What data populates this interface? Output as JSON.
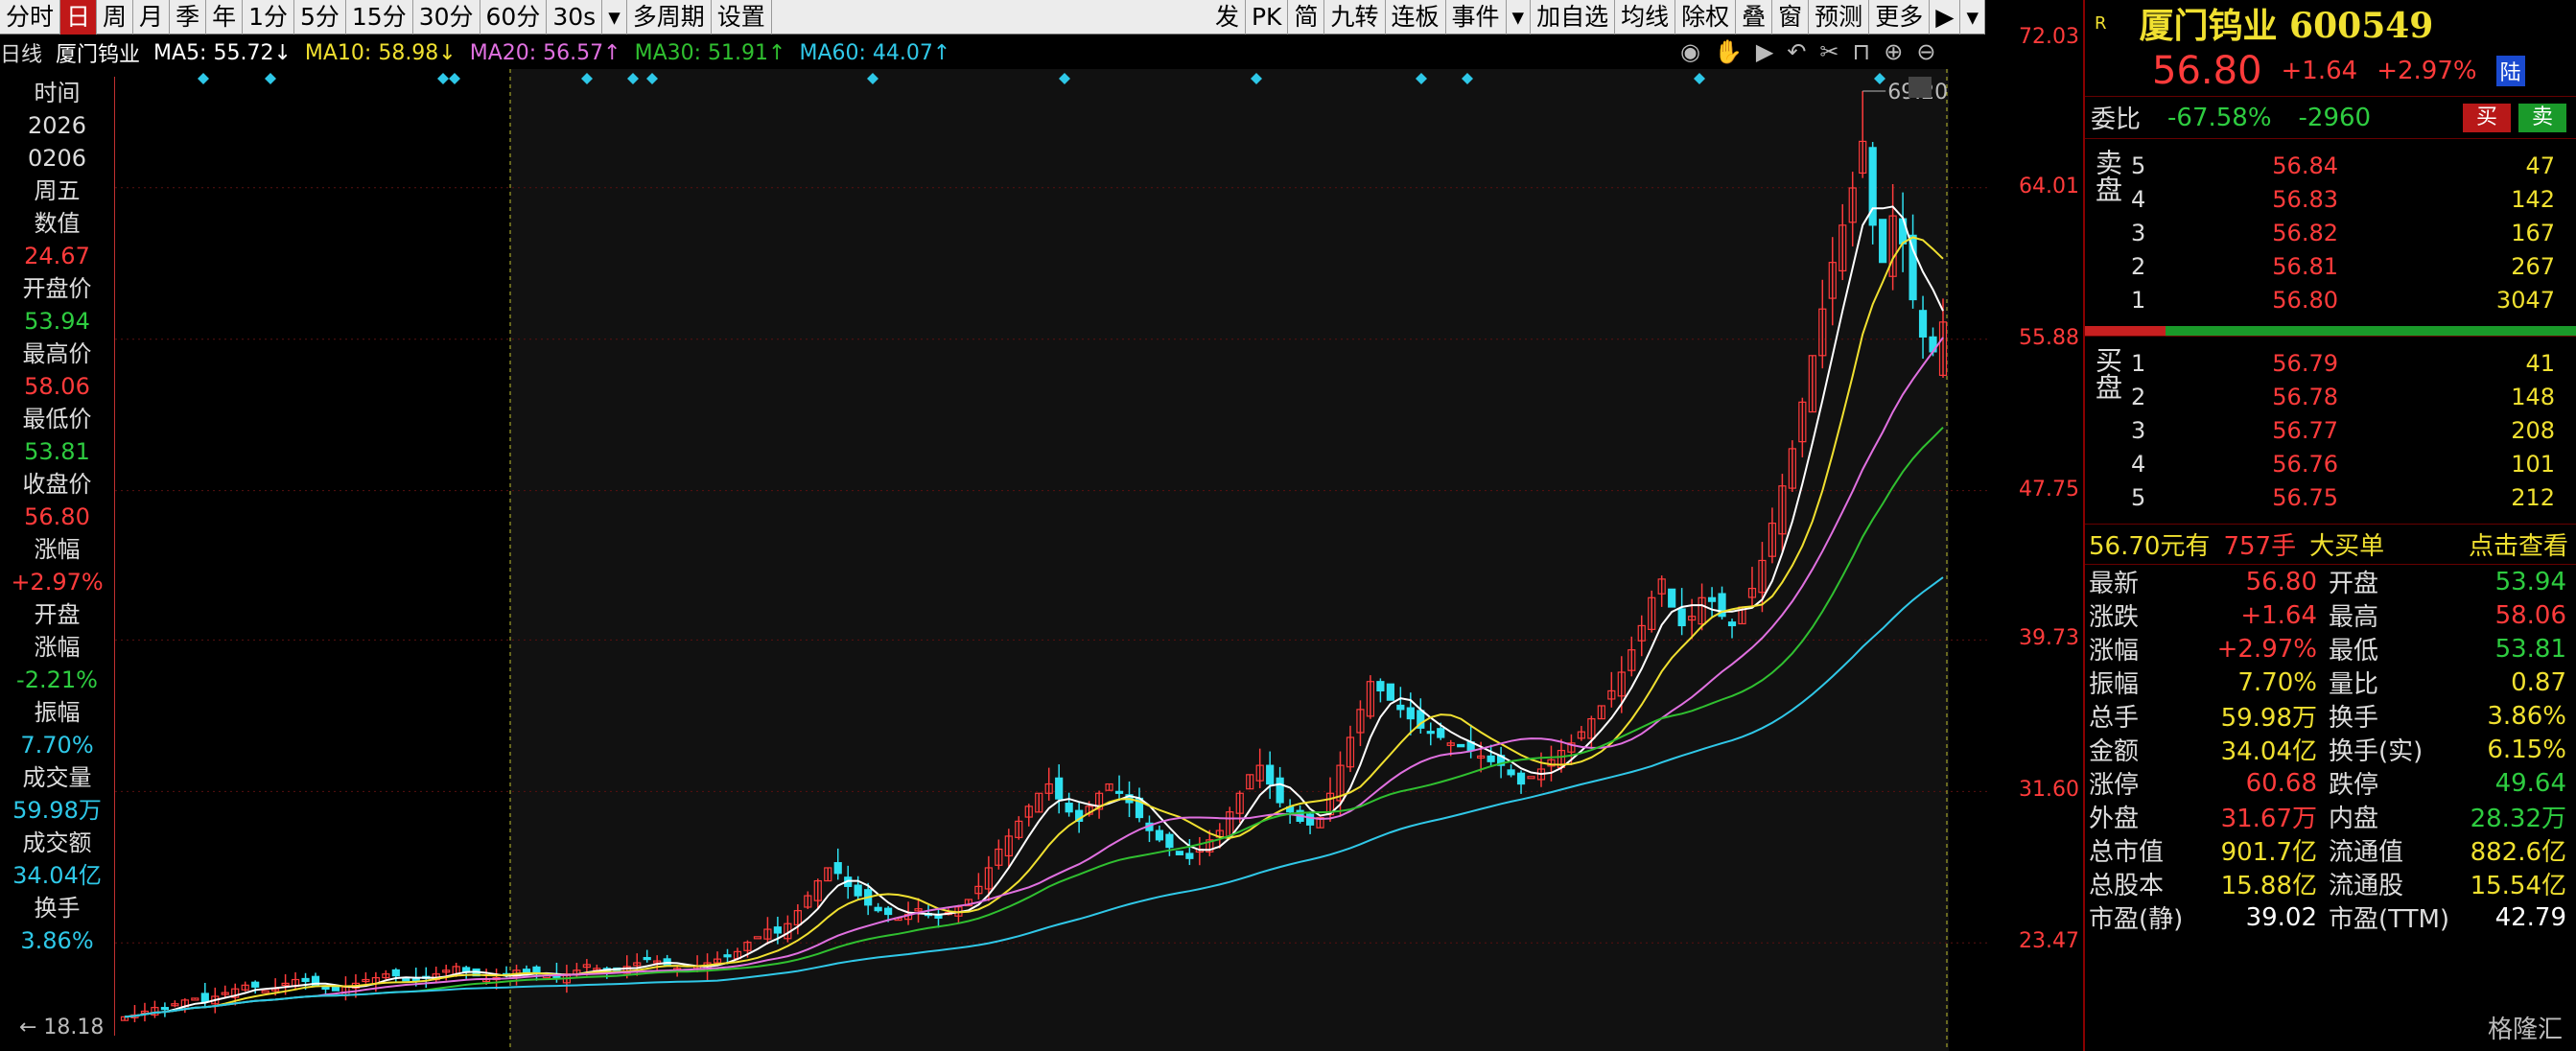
{
  "toolbar": {
    "left": [
      "分时",
      "日",
      "周",
      "月",
      "季",
      "年",
      "1分",
      "5分",
      "15分",
      "30分",
      "60分",
      "30s",
      "▾",
      "多周期",
      "设置"
    ],
    "right": [
      "发",
      "PK",
      "简",
      "九转",
      "连板",
      "事件",
      "▾",
      "加自选",
      "均线",
      "除权",
      "叠",
      "窗",
      "预测",
      "更多",
      "▶",
      "▾"
    ],
    "active": "日"
  },
  "legend": {
    "period": "日线",
    "name": "厦门钨业",
    "ma5": "MA5: 55.72↓",
    "ma10": "MA10: 58.98↓",
    "ma20": "MA20: 56.57↑",
    "ma30": "MA30: 51.91↑",
    "ma60": "MA60: 44.07↑",
    "colors": {
      "ma5": "#ffffff",
      "ma10": "#f0e030",
      "ma20": "#e070e0",
      "ma30": "#30c030",
      "ma60": "#30c8e8"
    }
  },
  "chart_icons": [
    "eye-icon",
    "hand-icon",
    "play-icon",
    "undo-icon",
    "scissors-icon",
    "lock-icon",
    "zoom-in-icon",
    "zoom-out-icon"
  ],
  "sidebar": {
    "time_label": "时间",
    "year": "2026",
    "date": "0206",
    "weekday": "周五",
    "value_label": "数值",
    "value": "24.67",
    "open_label": "开盘价",
    "open": "53.94",
    "high_label": "最高价",
    "high": "58.06",
    "low_label": "最低价",
    "low": "53.81",
    "close_label": "收盘价",
    "close": "56.80",
    "chg_label": "涨幅",
    "chg": "+2.97%",
    "open_chg_label1": "开盘",
    "open_chg_label2": "涨幅",
    "open_chg": "-2.21%",
    "amp_label": "振幅",
    "amp": "7.70%",
    "vol_label": "成交量",
    "vol": "59.98万",
    "amt_label": "成交额",
    "amt": "34.04亿",
    "turn_label": "换手",
    "turn": "3.86%"
  },
  "price_axis": {
    "ticks": [
      "72.03",
      "64.01",
      "55.88",
      "47.75",
      "39.73",
      "31.60",
      "23.47"
    ],
    "high_marker": "69.20",
    "low_marker": "18.18"
  },
  "panel": {
    "badge": "R",
    "title": "厦门钨业 600549",
    "price": "56.80",
    "chg": "+1.64",
    "pct": "+2.97%",
    "lu": "陆",
    "wb_label": "委比",
    "wb_pct": "-67.58%",
    "wb_diff": "-2960",
    "buy": "买",
    "sell": "卖",
    "sell_side": "卖盘",
    "buy_side": "买盘",
    "asks": [
      {
        "lv": "5",
        "p": "56.84",
        "v": "47"
      },
      {
        "lv": "4",
        "p": "56.83",
        "v": "142"
      },
      {
        "lv": "3",
        "p": "56.82",
        "v": "167"
      },
      {
        "lv": "2",
        "p": "56.81",
        "v": "267"
      },
      {
        "lv": "1",
        "p": "56.80",
        "v": "3047"
      }
    ],
    "bids": [
      {
        "lv": "1",
        "p": "56.79",
        "v": "41"
      },
      {
        "lv": "2",
        "p": "56.78",
        "v": "148"
      },
      {
        "lv": "3",
        "p": "56.77",
        "v": "208"
      },
      {
        "lv": "4",
        "p": "56.76",
        "v": "101"
      },
      {
        "lv": "5",
        "p": "56.75",
        "v": "212"
      }
    ],
    "bigorder": {
      "price": "56.70元有",
      "vol": "757手",
      "label": "大买单",
      "link": "点击查看"
    },
    "stats": [
      [
        "最新",
        "56.80",
        "red",
        "开盘",
        "53.94",
        "green"
      ],
      [
        "涨跌",
        "+1.64",
        "red",
        "最高",
        "58.06",
        "red"
      ],
      [
        "涨幅",
        "+2.97%",
        "red",
        "最低",
        "53.81",
        "green"
      ],
      [
        "振幅",
        "7.70%",
        "yellow",
        "量比",
        "0.87",
        "yellow"
      ],
      [
        "总手",
        "59.98万",
        "yellow",
        "换手",
        "3.86%",
        "yellow"
      ],
      [
        "金额",
        "34.04亿",
        "yellow",
        "换手(实)",
        "6.15%",
        "yellow"
      ],
      [
        "涨停",
        "60.68",
        "red",
        "跌停",
        "49.64",
        "green"
      ],
      [
        "外盘",
        "31.67万",
        "red",
        "内盘",
        "28.32万",
        "green"
      ],
      [
        "总市值",
        "901.7亿",
        "yellow",
        "流通值",
        "882.6亿",
        "yellow"
      ],
      [
        "总股本",
        "15.88亿",
        "yellow",
        "流通股",
        "15.54亿",
        "yellow"
      ],
      [
        "市盈(静)",
        "39.02",
        "white",
        "市盈(TTM)",
        "42.79",
        "white"
      ]
    ],
    "watermark": "格隆汇"
  },
  "chart_data": {
    "type": "candlestick",
    "y_range": [
      18.18,
      72.03
    ],
    "high": 69.2,
    "low": 18.18,
    "x": [
      "0206"
    ],
    "closes": [
      19.5,
      19.6,
      19.8,
      20.0,
      19.9,
      20.2,
      20.4,
      20.5,
      20.3,
      20.6,
      20.8,
      21.0,
      21.2,
      21.1,
      20.9,
      21.0,
      21.3,
      21.5,
      21.4,
      21.2,
      21.0,
      20.9,
      21.1,
      21.3,
      21.5,
      21.6,
      21.8,
      21.7,
      21.5,
      21.4,
      21.6,
      21.8,
      22.0,
      22.2,
      21.9,
      21.7,
      21.5,
      21.6,
      21.8,
      22.0,
      21.9,
      21.8,
      21.7,
      21.6,
      21.8,
      22.0,
      22.3,
      22.1,
      21.9,
      22.0,
      22.2,
      22.4,
      22.6,
      22.5,
      22.3,
      22.1,
      22.0,
      22.2,
      22.4,
      22.6,
      22.8,
      23.0,
      23.5,
      23.8,
      24.2,
      24.0,
      24.5,
      25.2,
      26.0,
      26.8,
      27.5,
      27.2,
      26.5,
      26.0,
      25.5,
      25.2,
      25.0,
      24.8,
      25.0,
      25.3,
      25.0,
      24.8,
      25.1,
      25.4,
      25.8,
      26.5,
      27.5,
      28.5,
      29.2,
      30.0,
      30.8,
      31.5,
      32.0,
      31.2,
      30.5,
      30.0,
      30.8,
      31.5,
      32.0,
      31.5,
      31.0,
      30.2,
      29.5,
      29.0,
      28.6,
      28.2,
      28.0,
      28.5,
      29.0,
      29.5,
      30.5,
      31.5,
      32.5,
      33.0,
      32.0,
      31.0,
      30.5,
      30.0,
      29.8,
      30.2,
      31.5,
      33.0,
      34.5,
      36.0,
      37.5,
      37.0,
      36.5,
      36.0,
      35.5,
      35.0,
      34.8,
      34.5,
      34.2,
      34.0,
      33.8,
      33.5,
      33.2,
      33.0,
      32.5,
      32.0,
      32.4,
      32.8,
      33.3,
      33.8,
      34.2,
      34.8,
      35.5,
      36.2,
      37.0,
      38.0,
      39.2,
      40.5,
      42.0,
      43.0,
      41.5,
      40.5,
      41.0,
      42.0,
      41.8,
      41.0,
      40.5,
      41.5,
      42.5,
      44.0,
      46.0,
      48.0,
      50.0,
      52.5,
      55.0,
      57.5,
      60.0,
      62.0,
      64.0,
      66.5,
      62.0,
      60.0,
      62.5,
      61.0,
      58.0,
      56.0,
      55.2,
      56.8
    ]
  }
}
